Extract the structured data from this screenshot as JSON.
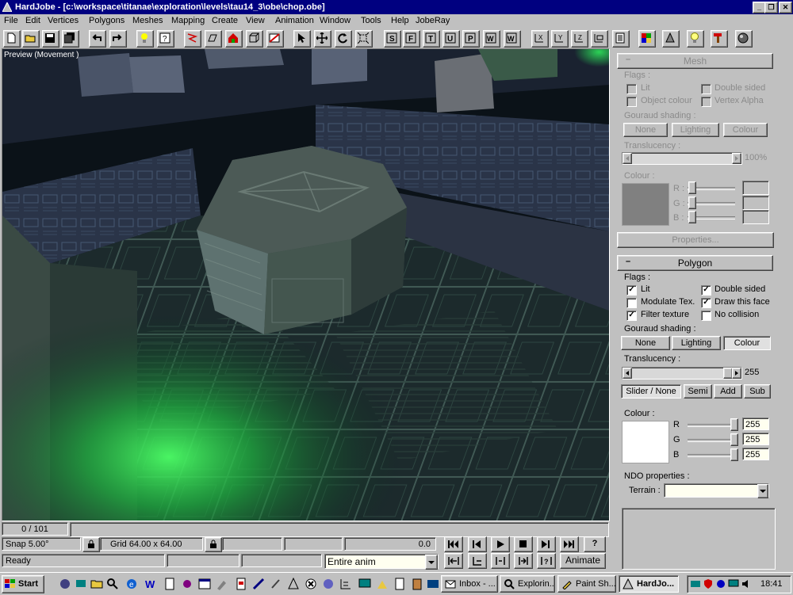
{
  "window": {
    "title": "HardJobe - [c:\\workspace\\titanae\\exploration\\levels\\tau14_3\\obe\\chop.obe]",
    "controls": [
      "_",
      "❐",
      "✕"
    ]
  },
  "menu": [
    "File",
    "Edit",
    "Vertices",
    "Polygons",
    "Meshes",
    "Mapping",
    "Create",
    "View",
    "Animation",
    "Window",
    "Tools",
    "Help",
    "JobeRay"
  ],
  "toolbar": {
    "letter_buttons": [
      "S",
      "F",
      "T",
      "U",
      "P",
      "W",
      "W"
    ],
    "axis_buttons": [
      "X",
      "Y",
      "Z"
    ]
  },
  "viewport": {
    "label": "Preview (Movement )"
  },
  "status": {
    "frame_counter": "0 / 101",
    "snap": "Snap 5.00°",
    "grid": "Grid 64.00 x 64.00",
    "time_value": "0.0",
    "ready": "Ready",
    "anim_select": "Entire anim",
    "animate_button": "Animate",
    "help_button": "?"
  },
  "mesh_panel": {
    "header": "Mesh",
    "flags_label": "Flags :",
    "flags": [
      {
        "label": "Lit",
        "checked": false
      },
      {
        "label": "Double sided",
        "checked": false
      },
      {
        "label": "Object colour",
        "checked": false
      },
      {
        "label": "Vertex Alpha",
        "checked": false
      }
    ],
    "gouraud_label": "Gouraud shading :",
    "gouraud_buttons": [
      "None",
      "Lighting",
      "Colour"
    ],
    "translucency_label": "Translucency :",
    "translucency_value": "100%",
    "colour_label": "Colour :",
    "rgb_labels": [
      "R :",
      "G :",
      "B :"
    ],
    "properties_button": "Properties..."
  },
  "polygon_panel": {
    "header": "Polygon",
    "flags_label": "Flags :",
    "flags": [
      {
        "label": "Lit",
        "checked": true
      },
      {
        "label": "Double sided",
        "checked": true
      },
      {
        "label": "Modulate Tex.",
        "checked": false
      },
      {
        "label": "Draw this face",
        "checked": true
      },
      {
        "label": "Filter texture",
        "checked": true
      },
      {
        "label": "No collision",
        "checked": false
      }
    ],
    "gouraud_label": "Gouraud shading :",
    "gouraud_buttons": [
      "None",
      "Lighting",
      "Colour"
    ],
    "translucency_label": "Translucency :",
    "translucency_value": "255",
    "blend_buttons": [
      "Slider / None",
      "Semi",
      "Add",
      "Sub"
    ],
    "colour_label": "Colour :",
    "rgb": [
      {
        "label": "R",
        "value": "255"
      },
      {
        "label": "G",
        "value": "255"
      },
      {
        "label": "B",
        "value": "255"
      }
    ],
    "ndo_label": "NDO properties :",
    "terrain_label": "Terrain :",
    "terrain_value": ""
  },
  "taskbar": {
    "start": "Start",
    "tasks": [
      "Inbox - ...",
      "Explorin...",
      "Paint Sh...",
      "HardJo..."
    ],
    "clock": "18:41"
  },
  "colors": {
    "title_bar": "#000080",
    "face": "#c0c0c0",
    "field_bg": "#fffff0",
    "scene_glow": "#2bff4a"
  }
}
